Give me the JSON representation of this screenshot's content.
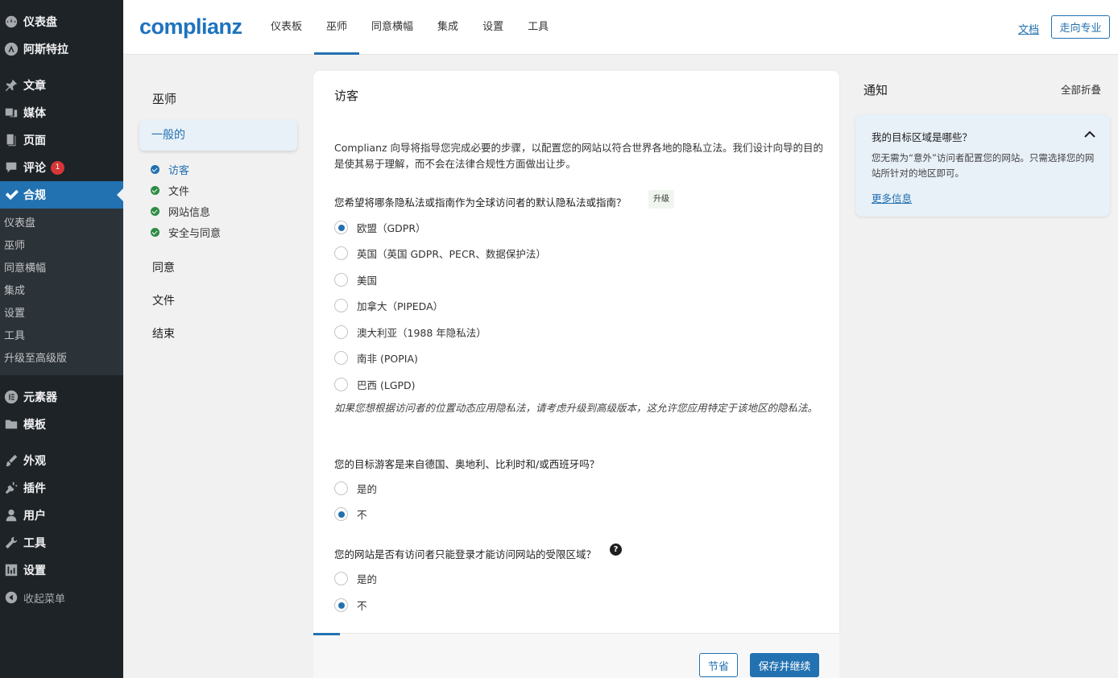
{
  "wp_sidebar": {
    "items_top": [
      {
        "label": "仪表盘",
        "icon": "dashboard-icon"
      },
      {
        "label": "阿斯特拉",
        "icon": "astra-icon"
      }
    ],
    "items_content": [
      {
        "label": "文章",
        "icon": "pin-icon"
      },
      {
        "label": "媒体",
        "icon": "media-icon"
      },
      {
        "label": "页面",
        "icon": "page-icon"
      },
      {
        "label": "评论",
        "icon": "comment-icon",
        "badge": "1"
      }
    ],
    "active": {
      "label": "合规",
      "icon": "check-icon"
    },
    "submenu": [
      "仪表盘",
      "巫师",
      "同意横幅",
      "集成",
      "设置",
      "工具",
      "升级至高级版"
    ],
    "items_bottom1": [
      {
        "label": "元素器",
        "icon": "elementor-icon"
      },
      {
        "label": "模板",
        "icon": "folder-icon"
      }
    ],
    "items_bottom2": [
      {
        "label": "外观",
        "icon": "brush-icon"
      },
      {
        "label": "插件",
        "icon": "plugin-icon"
      },
      {
        "label": "用户",
        "icon": "user-icon"
      },
      {
        "label": "工具",
        "icon": "wrench-icon"
      },
      {
        "label": "设置",
        "icon": "settings-icon"
      }
    ],
    "collapse": "收起菜单"
  },
  "header": {
    "logo": "complianz",
    "tabs": [
      "仪表板",
      "巫师",
      "同意横幅",
      "集成",
      "设置",
      "工具"
    ],
    "active_tab": 1,
    "docs": "文档",
    "pro": "走向专业"
  },
  "wizard_nav": {
    "title": "巫师",
    "active_section": "一般的",
    "steps": [
      {
        "label": "访客",
        "current": true
      },
      {
        "label": "文件",
        "current": false
      },
      {
        "label": "网站信息",
        "current": false
      },
      {
        "label": "安全与同意",
        "current": false
      }
    ],
    "sections": [
      "同意",
      "文件",
      "结束"
    ]
  },
  "card": {
    "title": "访客",
    "intro": "Complianz 向导将指导您完成必要的步骤，以配置您的网站以符合世界各地的隐私立法。我们设计向导的目的是使其易于理解，而不会在法律合规性方面做出让步。",
    "q1": "您希望将哪条隐私法或指南作为全球访问者的默认隐私法或指南？",
    "upgrade": "升级",
    "q1_options": [
      "欧盟（GDPR）",
      "英国（英国 GDPR、PECR、数据保护法）",
      "美国",
      "加拿大（PIPEDA）",
      "澳大利亚（1988 年隐私法）",
      "南非 (POPIA)",
      "巴西 (LGPD)"
    ],
    "q1_selected": 0,
    "note": "如果您想根据访问者的位置动态应用隐私法，请考虑升级到高级版本，这允许您应用特定于该地区的隐私法。",
    "q2": "您的目标游客是来自德国、奥地利、比利时和/或西班牙吗？",
    "q2_options": [
      "是的",
      "不"
    ],
    "q2_selected": 1,
    "q3": "您的网站是否有访问者只能登录才能访问网站的受限区域？",
    "q3_options": [
      "是的",
      "不"
    ],
    "q3_selected": 1,
    "help": "?",
    "save": "节省",
    "save_continue": "保存并继续",
    "progress_percent": 5
  },
  "notices": {
    "title": "通知",
    "collapse_all": "全部折叠",
    "notice_title": "我的目标区域是哪些？",
    "notice_body": "您无需为“意外”访问者配置您的网站。只需选择您的网站所针对的地区即可。",
    "more_info": "更多信息"
  },
  "colors": {
    "accent": "#2271b1",
    "sidebar_bg": "#1d2327",
    "success": "#2e8b46",
    "badge": "#d63638"
  }
}
